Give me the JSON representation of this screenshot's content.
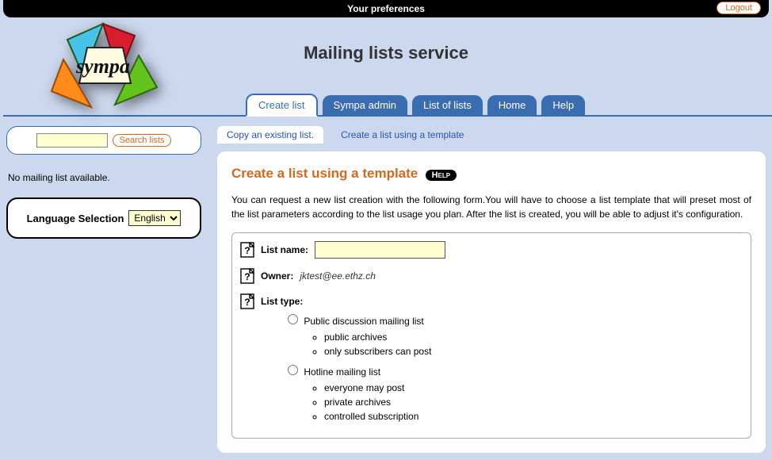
{
  "topbar": {
    "prefs": "Your preferences",
    "logout": "Logout"
  },
  "pageTitle": "Mailing lists service",
  "nav": {
    "create": "Create list",
    "admin": "Sympa admin",
    "listoflists": "List of lists",
    "home": "Home",
    "help": "Help"
  },
  "left": {
    "searchBtn": "Search lists",
    "noList": "No mailing list available.",
    "langLabel": "Language Selection",
    "langValue": "English"
  },
  "subtabs": {
    "copy": "Copy an existing list.",
    "template": "Create a list using a template"
  },
  "panel": {
    "heading": "Create a list using a template",
    "help": "Help",
    "intro": "You can request a new list creation with the following form.You will have to choose a list template that will preset most of the list parameters according to the list usage you plan. After the list is created, you will be able to adjust it's configuration.",
    "listNameLabel": "List name:",
    "ownerLabel": "Owner:",
    "ownerEmail": "jktest@ee.ethz.ch",
    "listTypeLabel": "List type:",
    "types": {
      "public": {
        "label": "Public discussion mailing list",
        "items": [
          "public archives",
          "only subscribers can post"
        ]
      },
      "hotline": {
        "label": "Hotline mailing list",
        "items": [
          "everyone may post",
          "private archives",
          "controlled subscription"
        ]
      }
    }
  }
}
